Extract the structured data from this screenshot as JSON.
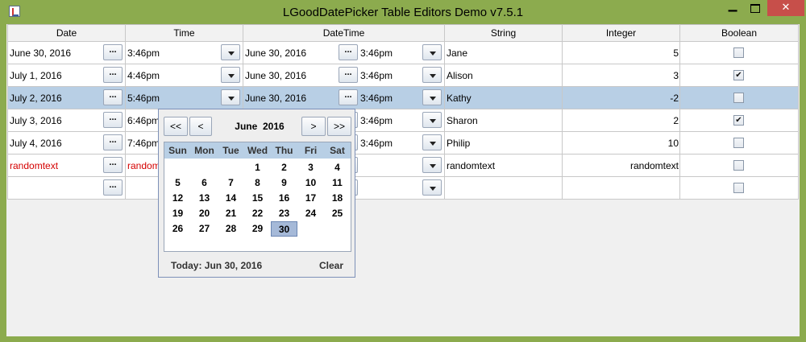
{
  "window": {
    "title": "LGoodDatePicker Table Editors Demo v7.5.1",
    "minimize": "▁",
    "close": "✕"
  },
  "table": {
    "headers": [
      "Date",
      "Time",
      "DateTime",
      "String",
      "Integer",
      "Boolean"
    ],
    "selected_row": 2,
    "dots_label": "...",
    "rows": [
      {
        "date": "June 30, 2016",
        "time": "3:46pm",
        "dt_date": "June 30, 2016",
        "dt_time": "3:46pm",
        "string": "Jane",
        "integer": "5",
        "boolean": false,
        "error": false
      },
      {
        "date": "July 1, 2016",
        "time": "4:46pm",
        "dt_date": "June 30, 2016",
        "dt_time": "3:46pm",
        "string": "Alison",
        "integer": "3",
        "boolean": true,
        "error": false
      },
      {
        "date": "July 2, 2016",
        "time": "5:46pm",
        "dt_date": "June 30, 2016",
        "dt_time": "3:46pm",
        "string": "Kathy",
        "integer": "-2",
        "boolean": false,
        "error": false
      },
      {
        "date": "July 3, 2016",
        "time": "6:46pm",
        "dt_date": "",
        "dt_time": "3:46pm",
        "string": "Sharon",
        "integer": "2",
        "boolean": true,
        "error": false
      },
      {
        "date": "July 4, 2016",
        "time": "7:46pm",
        "dt_date": "",
        "dt_time": "3:46pm",
        "string": "Philip",
        "integer": "10",
        "boolean": false,
        "error": false
      },
      {
        "date": "randomtext",
        "time": "random",
        "dt_date": "",
        "dt_time": "",
        "string": "randomtext",
        "integer": "randomtext",
        "boolean": false,
        "error": true
      },
      {
        "date": "",
        "time": "",
        "dt_date": "",
        "dt_time": "",
        "string": "",
        "integer": "",
        "boolean": false,
        "error": false
      }
    ]
  },
  "calendar": {
    "prev_year": "<<",
    "prev_month": "<",
    "next_month": ">",
    "next_year": ">>",
    "month": "June",
    "year": "2016",
    "weekdays": [
      "Sun",
      "Mon",
      "Tue",
      "Wed",
      "Thu",
      "Fri",
      "Sat"
    ],
    "first_weekday_index": 3,
    "days_in_month": 30,
    "selected_day": 30,
    "today_label": "Today:  Jun 30, 2016",
    "clear_label": "Clear"
  },
  "colors": {
    "frame": "#8cab4e",
    "selection": "#b8cfe5",
    "error_text": "#d40000",
    "close_button": "#c74f4a"
  }
}
